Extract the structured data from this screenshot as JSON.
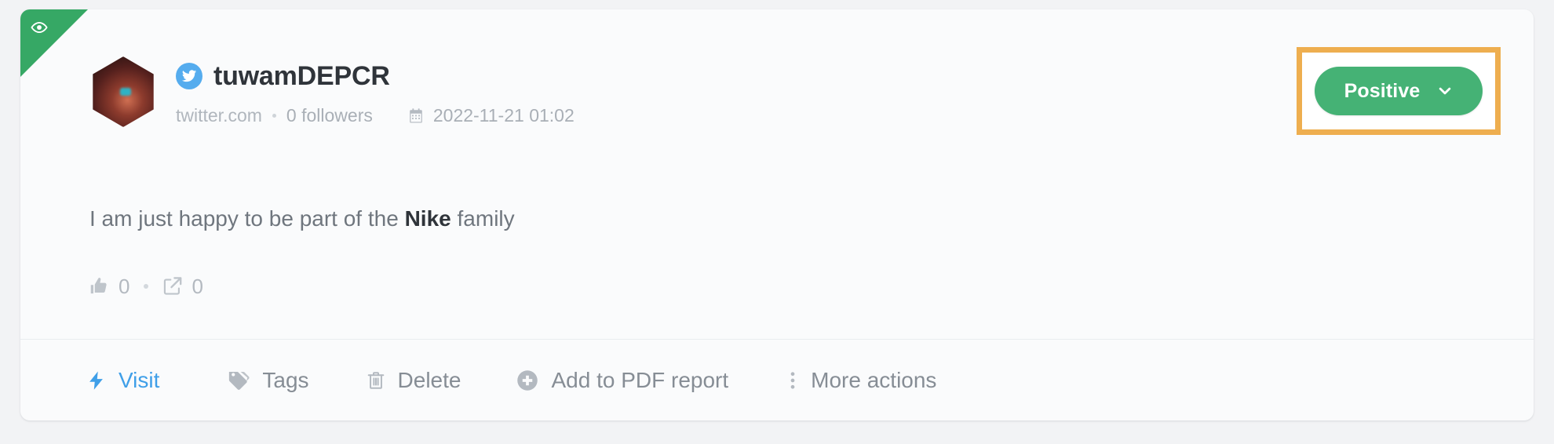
{
  "card": {
    "ribbon": {
      "icon": "eye-icon",
      "color": "#36a865"
    },
    "avatar": {
      "icon": "user-avatar"
    }
  },
  "header": {
    "source_icon": "twitter-icon",
    "username": "tuwamDEPCR",
    "domain": "twitter.com",
    "followers": "0 followers",
    "calendar_icon": "calendar-icon",
    "date": "2022-11-21 01:02"
  },
  "sentiment": {
    "label": "Positive",
    "chevron_icon": "chevron-down-icon",
    "badge_color": "#45b275",
    "highlight_color": "#eeae4f"
  },
  "post": {
    "text_before": "I am just happy to be part of the ",
    "text_bold": "Nike",
    "text_after": " family"
  },
  "stats": {
    "likes_icon": "thumbs-up-icon",
    "likes": "0",
    "shares_icon": "share-icon",
    "shares": "0"
  },
  "actions": [
    {
      "label": "Visit",
      "icon": "lightning-bolt-icon",
      "color": "#3f9fe8"
    },
    {
      "label": "Tags",
      "icon": "tag-icon",
      "color": "#868d95"
    },
    {
      "label": "Delete",
      "icon": "trash-icon",
      "color": "#868d95"
    },
    {
      "label": "Add to PDF report",
      "icon": "plus-circle-icon",
      "color": "#868d95"
    },
    {
      "label": "More actions",
      "icon": "dots-vertical-icon",
      "color": "#868d95"
    }
  ]
}
